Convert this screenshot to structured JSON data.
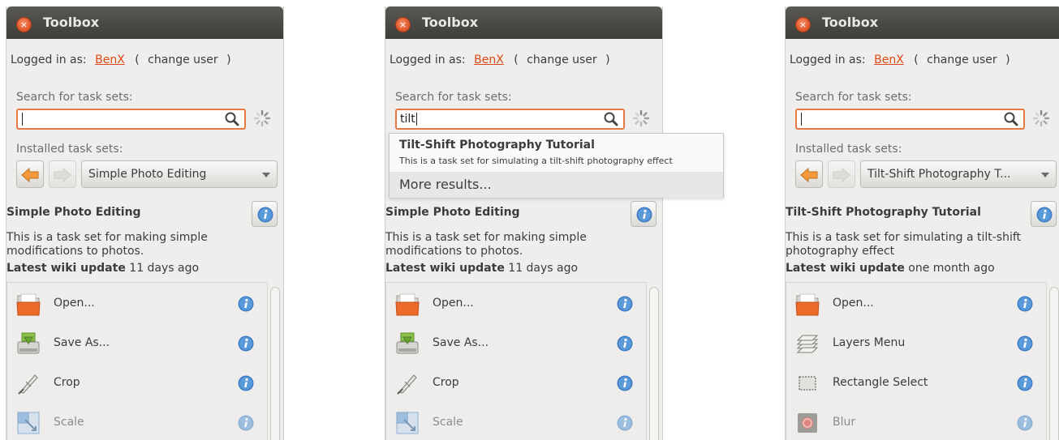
{
  "panels": [
    {
      "title": "Toolbox",
      "logged_in_label": "Logged in as:",
      "user": "BenX",
      "open_paren": "(",
      "change_user": "change user",
      "close_paren": ")",
      "search_label": "Search for task sets:",
      "search_value": "",
      "installed_label": "Installed task sets:",
      "selected_set": "Simple Photo Editing",
      "set_title": "Simple Photo Editing",
      "set_desc": "This is a task set for making simple modifications to photos.",
      "wiki_label": "Latest wiki update",
      "wiki_value": "11 days ago",
      "items": [
        {
          "label": "Open...",
          "icon": "folder-open-icon"
        },
        {
          "label": "Save As...",
          "icon": "save-drive-icon"
        },
        {
          "label": "Crop",
          "icon": "crop-knife-icon"
        },
        {
          "label": "Scale",
          "icon": "scale-icon"
        }
      ]
    },
    {
      "title": "Toolbox",
      "logged_in_label": "Logged in as:",
      "user": "BenX",
      "open_paren": "(",
      "change_user": "change user",
      "close_paren": ")",
      "search_label": "Search for task sets:",
      "search_value": "tilt",
      "set_title": "Simple Photo Editing",
      "set_desc": "This is a task set for making simple modifications to photos.",
      "wiki_label": "Latest wiki update",
      "wiki_value": "11 days ago",
      "suggestion_title": "Tilt-Shift Photography Tutorial",
      "suggestion_desc": "This is a task set for simulating a tilt-shift photography effect",
      "more_results": "More results...",
      "items": [
        {
          "label": "Open...",
          "icon": "folder-open-icon"
        },
        {
          "label": "Save As...",
          "icon": "save-drive-icon"
        },
        {
          "label": "Crop",
          "icon": "crop-knife-icon"
        },
        {
          "label": "Scale",
          "icon": "scale-icon"
        }
      ]
    },
    {
      "title": "Toolbox",
      "logged_in_label": "Logged in as:",
      "user": "BenX",
      "open_paren": "(",
      "change_user": "change user",
      "close_paren": ")",
      "search_label": "Search for task sets:",
      "search_value": "",
      "installed_label": "Installed task sets:",
      "selected_set": "Tilt-Shift Photography T...",
      "set_title": "Tilt-Shift Photography Tutorial",
      "set_desc": "This is a task set for simulating a tilt-shift photography effect",
      "wiki_label": "Latest wiki update",
      "wiki_value": "one month ago",
      "items": [
        {
          "label": "Open...",
          "icon": "folder-open-icon"
        },
        {
          "label": "Layers Menu",
          "icon": "layers-icon"
        },
        {
          "label": "Rectangle Select",
          "icon": "rectangle-select-icon"
        },
        {
          "label": "Blur",
          "icon": "blur-icon"
        }
      ]
    }
  ]
}
